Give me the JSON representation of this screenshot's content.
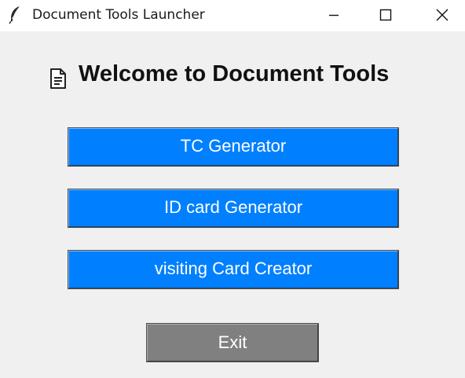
{
  "window": {
    "title": "Document Tools Launcher",
    "app_icon": "feather-icon",
    "controls": [
      "minimize-icon",
      "maximize-icon",
      "close-icon"
    ]
  },
  "main": {
    "heading": "Welcome to Document Tools",
    "heading_icon": "document-icon",
    "buttons": [
      {
        "label": "TC Generator",
        "color": "#0080ff"
      },
      {
        "label": "ID card Generator",
        "color": "#0080ff"
      },
      {
        "label": "visiting Card Creator",
        "color": "#0080ff"
      }
    ],
    "exit_button": {
      "label": "Exit",
      "color": "#808080"
    }
  },
  "colors": {
    "background": "#f0f0f0",
    "titlebar": "#ffffff",
    "text_on_button": "#ffffff"
  }
}
